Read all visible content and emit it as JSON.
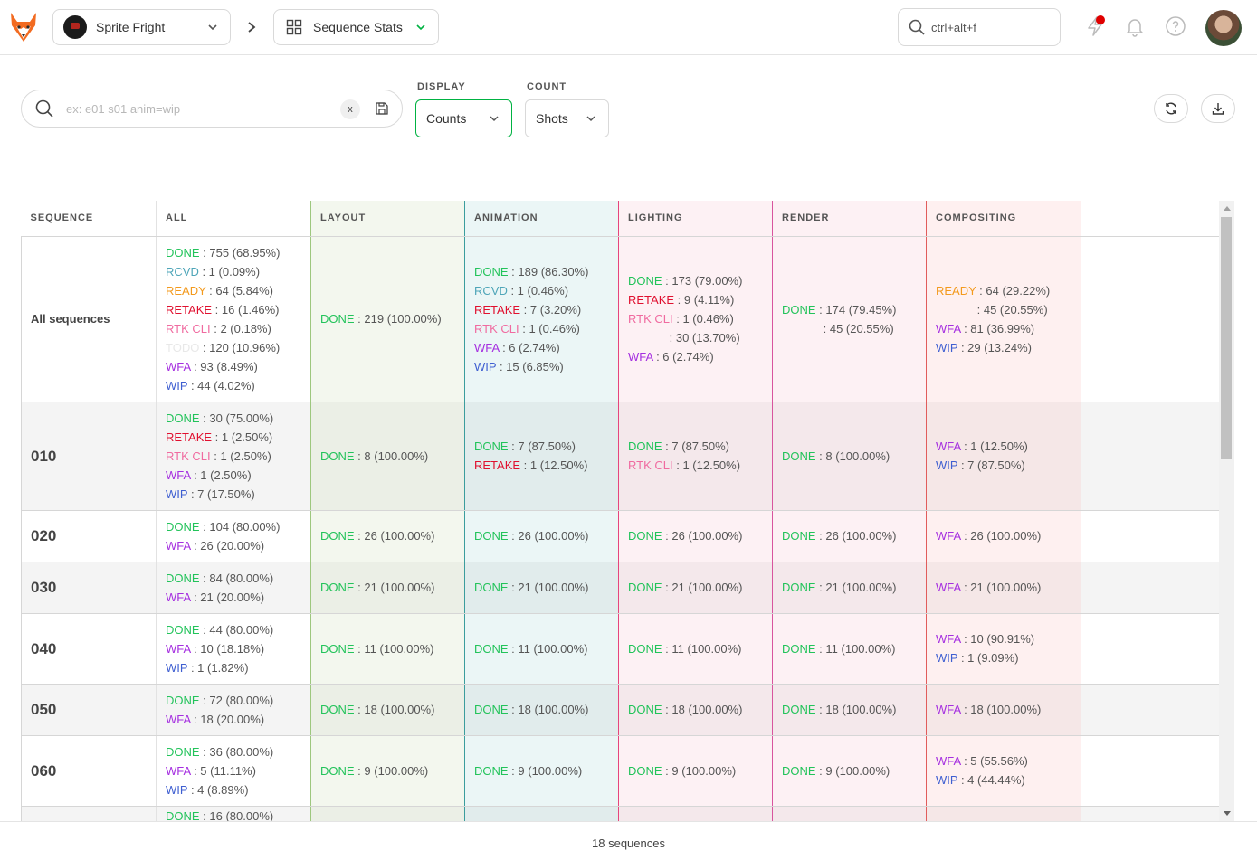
{
  "topbar": {
    "production": "Sprite Fright",
    "view": "Sequence Stats",
    "search_placeholder": "ctrl+alt+f"
  },
  "filters": {
    "search_placeholder": "ex: e01 s01 anim=wip",
    "clear_label": "x",
    "display_label": "DISPLAY",
    "display_value": "Counts",
    "count_label": "COUNT",
    "count_value": "Shots"
  },
  "colors": {
    "DONE": "#22c35a",
    "RCVD": "#4ea5b8",
    "READY": "#f39a1e",
    "RETAKE": "#e0102f",
    "RTK CLI": "#f06ba0",
    "TODO": "#e8e8e8",
    "WFA": "#a52fe0",
    "WIP": "#3f5fd1",
    "blank": "transparent"
  },
  "columns": [
    {
      "label": "SEQUENCE",
      "bg": "#ffffff",
      "bg_odd": "#f4f4f4",
      "line": "#d6d6d6"
    },
    {
      "label": "ALL",
      "bg": "#ffffff",
      "bg_odd": "#f4f4f4",
      "line": "#e2e2e2"
    },
    {
      "label": "LAYOUT",
      "bg": "#f3f7ee",
      "bg_odd": "#ebefe6",
      "line": "#9dc77e"
    },
    {
      "label": "ANIMATION",
      "bg": "#ebf6f6",
      "bg_odd": "#e1ecec",
      "line": "#3b9d9d"
    },
    {
      "label": "LIGHTING",
      "bg": "#fdf1f4",
      "bg_odd": "#f4e8eb",
      "line": "#e6457c"
    },
    {
      "label": "RENDER",
      "bg": "#fdf1f4",
      "bg_odd": "#f4e8eb",
      "line": "#d8559e"
    },
    {
      "label": "COMPOSITING",
      "bg": "#fef0f0",
      "bg_odd": "#f5e7e7",
      "line": "#e15c5c"
    }
  ],
  "rows": [
    {
      "name": "All sequences",
      "cells": [
        [
          {
            "s": "DONE",
            "v": " : 755 (68.95%)"
          },
          {
            "s": "RCVD",
            "v": " : 1 (0.09%)"
          },
          {
            "s": "READY",
            "v": " : 64 (5.84%)"
          },
          {
            "s": "RETAKE",
            "v": " : 16 (1.46%)"
          },
          {
            "s": "RTK CLI",
            "v": " : 2 (0.18%)"
          },
          {
            "s": "TODO",
            "v": " : 120 (10.96%)"
          },
          {
            "s": "WFA",
            "v": " : 93 (8.49%)"
          },
          {
            "s": "WIP",
            "v": " : 44 (4.02%)"
          }
        ],
        [
          {
            "s": "DONE",
            "v": " : 219 (100.00%)"
          }
        ],
        [
          {
            "s": "DONE",
            "v": " : 189 (86.30%)"
          },
          {
            "s": "RCVD",
            "v": " : 1 (0.46%)"
          },
          {
            "s": "RETAKE",
            "v": " : 7 (3.20%)"
          },
          {
            "s": "RTK CLI",
            "v": " : 1 (0.46%)"
          },
          {
            "s": "WFA",
            "v": " : 6 (2.74%)"
          },
          {
            "s": "WIP",
            "v": " : 15 (6.85%)"
          }
        ],
        [
          {
            "s": "DONE",
            "v": " : 173 (79.00%)"
          },
          {
            "s": "RETAKE",
            "v": " : 9 (4.11%)"
          },
          {
            "s": "RTK CLI",
            "v": " : 1 (0.46%)"
          },
          {
            "s": "blank",
            "v": " : 30 (13.70%)"
          },
          {
            "s": "WFA",
            "v": " : 6 (2.74%)"
          }
        ],
        [
          {
            "s": "DONE",
            "v": " : 174 (79.45%)"
          },
          {
            "s": "blank",
            "v": " : 45 (20.55%)"
          }
        ],
        [
          {
            "s": "READY",
            "v": " : 64 (29.22%)"
          },
          {
            "s": "blank",
            "v": " : 45 (20.55%)"
          },
          {
            "s": "WFA",
            "v": " : 81 (36.99%)"
          },
          {
            "s": "WIP",
            "v": " : 29 (13.24%)"
          }
        ]
      ]
    },
    {
      "name": "010",
      "cells": [
        [
          {
            "s": "DONE",
            "v": " : 30 (75.00%)"
          },
          {
            "s": "RETAKE",
            "v": " : 1 (2.50%)"
          },
          {
            "s": "RTK CLI",
            "v": " : 1 (2.50%)"
          },
          {
            "s": "WFA",
            "v": " : 1 (2.50%)"
          },
          {
            "s": "WIP",
            "v": " : 7 (17.50%)"
          }
        ],
        [
          {
            "s": "DONE",
            "v": " : 8 (100.00%)"
          }
        ],
        [
          {
            "s": "DONE",
            "v": " : 7 (87.50%)"
          },
          {
            "s": "RETAKE",
            "v": " : 1 (12.50%)"
          }
        ],
        [
          {
            "s": "DONE",
            "v": " : 7 (87.50%)"
          },
          {
            "s": "RTK CLI",
            "v": " : 1 (12.50%)"
          }
        ],
        [
          {
            "s": "DONE",
            "v": " : 8 (100.00%)"
          }
        ],
        [
          {
            "s": "WFA",
            "v": " : 1 (12.50%)"
          },
          {
            "s": "WIP",
            "v": " : 7 (87.50%)"
          }
        ]
      ]
    },
    {
      "name": "020",
      "cells": [
        [
          {
            "s": "DONE",
            "v": " : 104 (80.00%)"
          },
          {
            "s": "WFA",
            "v": " : 26 (20.00%)"
          }
        ],
        [
          {
            "s": "DONE",
            "v": " : 26 (100.00%)"
          }
        ],
        [
          {
            "s": "DONE",
            "v": " : 26 (100.00%)"
          }
        ],
        [
          {
            "s": "DONE",
            "v": " : 26 (100.00%)"
          }
        ],
        [
          {
            "s": "DONE",
            "v": " : 26 (100.00%)"
          }
        ],
        [
          {
            "s": "WFA",
            "v": " : 26 (100.00%)"
          }
        ]
      ]
    },
    {
      "name": "030",
      "cells": [
        [
          {
            "s": "DONE",
            "v": " : 84 (80.00%)"
          },
          {
            "s": "WFA",
            "v": " : 21 (20.00%)"
          }
        ],
        [
          {
            "s": "DONE",
            "v": " : 21 (100.00%)"
          }
        ],
        [
          {
            "s": "DONE",
            "v": " : 21 (100.00%)"
          }
        ],
        [
          {
            "s": "DONE",
            "v": " : 21 (100.00%)"
          }
        ],
        [
          {
            "s": "DONE",
            "v": " : 21 (100.00%)"
          }
        ],
        [
          {
            "s": "WFA",
            "v": " : 21 (100.00%)"
          }
        ]
      ]
    },
    {
      "name": "040",
      "cells": [
        [
          {
            "s": "DONE",
            "v": " : 44 (80.00%)"
          },
          {
            "s": "WFA",
            "v": " : 10 (18.18%)"
          },
          {
            "s": "WIP",
            "v": " : 1 (1.82%)"
          }
        ],
        [
          {
            "s": "DONE",
            "v": " : 11 (100.00%)"
          }
        ],
        [
          {
            "s": "DONE",
            "v": " : 11 (100.00%)"
          }
        ],
        [
          {
            "s": "DONE",
            "v": " : 11 (100.00%)"
          }
        ],
        [
          {
            "s": "DONE",
            "v": " : 11 (100.00%)"
          }
        ],
        [
          {
            "s": "WFA",
            "v": " : 10 (90.91%)"
          },
          {
            "s": "WIP",
            "v": " : 1 (9.09%)"
          }
        ]
      ]
    },
    {
      "name": "050",
      "cells": [
        [
          {
            "s": "DONE",
            "v": " : 72 (80.00%)"
          },
          {
            "s": "WFA",
            "v": " : 18 (20.00%)"
          }
        ],
        [
          {
            "s": "DONE",
            "v": " : 18 (100.00%)"
          }
        ],
        [
          {
            "s": "DONE",
            "v": " : 18 (100.00%)"
          }
        ],
        [
          {
            "s": "DONE",
            "v": " : 18 (100.00%)"
          }
        ],
        [
          {
            "s": "DONE",
            "v": " : 18 (100.00%)"
          }
        ],
        [
          {
            "s": "WFA",
            "v": " : 18 (100.00%)"
          }
        ]
      ]
    },
    {
      "name": "060",
      "cells": [
        [
          {
            "s": "DONE",
            "v": " : 36 (80.00%)"
          },
          {
            "s": "WFA",
            "v": " : 5 (11.11%)"
          },
          {
            "s": "WIP",
            "v": " : 4 (8.89%)"
          }
        ],
        [
          {
            "s": "DONE",
            "v": " : 9 (100.00%)"
          }
        ],
        [
          {
            "s": "DONE",
            "v": " : 9 (100.00%)"
          }
        ],
        [
          {
            "s": "DONE",
            "v": " : 9 (100.00%)"
          }
        ],
        [
          {
            "s": "DONE",
            "v": " : 9 (100.00%)"
          }
        ],
        [
          {
            "s": "WFA",
            "v": " : 5 (55.56%)"
          },
          {
            "s": "WIP",
            "v": " : 4 (44.44%)"
          }
        ]
      ]
    },
    {
      "name": "",
      "cells": [
        [
          {
            "s": "DONE",
            "v": " : 16 (80.00%)"
          }
        ],
        [],
        [],
        [],
        [],
        []
      ]
    }
  ],
  "footer": {
    "count_text": "18 sequences"
  }
}
